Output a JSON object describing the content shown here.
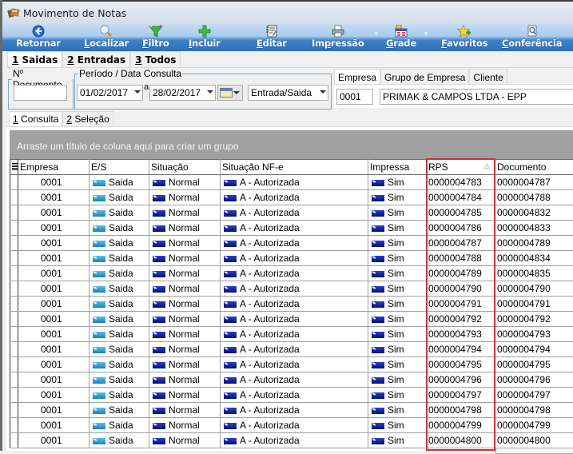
{
  "window": {
    "title": "Movimento de Notas"
  },
  "toolbar": {
    "buttons": [
      {
        "label": "Retornar",
        "accel": "",
        "icon": "back-arrow-icon"
      },
      {
        "label": "Localizar",
        "accel": "L",
        "icon": "magnifier-icon"
      },
      {
        "label": "Filtro",
        "accel": "F",
        "icon": "funnel-icon"
      },
      {
        "label": "Incluir",
        "accel": "I",
        "icon": "plus-icon"
      },
      {
        "label": "Editar",
        "accel": "E",
        "icon": "edit-document-icon"
      },
      {
        "label": "Impressão",
        "accel": "p",
        "icon": "printer-icon",
        "dropdown": true
      },
      {
        "label": "Grade",
        "accel": "G",
        "icon": "grid-icon",
        "dropdown": true
      },
      {
        "label": "Favoritos",
        "accel": "F",
        "icon": "star-icon"
      },
      {
        "label": "Conferência",
        "accel": "C",
        "icon": "check-document-icon"
      }
    ]
  },
  "main_tabs": [
    {
      "key": "1",
      "label": " Saidas",
      "active": true
    },
    {
      "key": "2",
      "label": " Entradas",
      "active": false
    },
    {
      "key": "3",
      "label": " Todos",
      "active": false
    }
  ],
  "filters": {
    "documento_legend": "Nº Documento",
    "documento_value": "",
    "periodo_legend": "Período / Data Consulta",
    "date_from": "01/02/2017",
    "date_separator": "a",
    "date_to": "28/02/2017",
    "tipo_value": "Entrada/Saida"
  },
  "empresa": {
    "tabs": [
      "Empresa",
      "Grupo de Empresa",
      "Cliente"
    ],
    "active_tab": "Empresa",
    "code": "0001",
    "name": "PRIMAK & CAMPOS LTDA - EPP"
  },
  "sub_tabs": [
    {
      "key": "1",
      "label": " Consulta",
      "active": true
    },
    {
      "key": "2",
      "label": " Seleção",
      "active": false
    }
  ],
  "grid": {
    "group_panel_text": "Arraste um título de coluna aqui para criar um grupo",
    "columns": [
      "Empresa",
      "E/S",
      "Situação",
      "Situação NF-e",
      "Impressa",
      "RPS",
      "Documento"
    ],
    "sorted_column": "RPS",
    "sort_direction": "ascending",
    "highlighted_column": "RPS",
    "rows": [
      [
        "0001",
        "Saida",
        "Normal",
        "A - Autorizada",
        "Sim",
        "0000004783",
        "0000004787"
      ],
      [
        "0001",
        "Saida",
        "Normal",
        "A - Autorizada",
        "Sim",
        "0000004784",
        "0000004788"
      ],
      [
        "0001",
        "Saida",
        "Normal",
        "A - Autorizada",
        "Sim",
        "0000004785",
        "0000004832"
      ],
      [
        "0001",
        "Saida",
        "Normal",
        "A - Autorizada",
        "Sim",
        "0000004786",
        "0000004833"
      ],
      [
        "0001",
        "Saida",
        "Normal",
        "A - Autorizada",
        "Sim",
        "0000004787",
        "0000004789"
      ],
      [
        "0001",
        "Saida",
        "Normal",
        "A - Autorizada",
        "Sim",
        "0000004788",
        "0000004834"
      ],
      [
        "0001",
        "Saida",
        "Normal",
        "A - Autorizada",
        "Sim",
        "0000004789",
        "0000004835"
      ],
      [
        "0001",
        "Saida",
        "Normal",
        "A - Autorizada",
        "Sim",
        "0000004790",
        "0000004790"
      ],
      [
        "0001",
        "Saida",
        "Normal",
        "A - Autorizada",
        "Sim",
        "0000004791",
        "0000004791"
      ],
      [
        "0001",
        "Saida",
        "Normal",
        "A - Autorizada",
        "Sim",
        "0000004792",
        "0000004792"
      ],
      [
        "0001",
        "Saida",
        "Normal",
        "A - Autorizada",
        "Sim",
        "0000004793",
        "0000004793"
      ],
      [
        "0001",
        "Saida",
        "Normal",
        "A - Autorizada",
        "Sim",
        "0000004794",
        "0000004794"
      ],
      [
        "0001",
        "Saida",
        "Normal",
        "A - Autorizada",
        "Sim",
        "0000004795",
        "0000004795"
      ],
      [
        "0001",
        "Saida",
        "Normal",
        "A - Autorizada",
        "Sim",
        "0000004796",
        "0000004796"
      ],
      [
        "0001",
        "Saida",
        "Normal",
        "A - Autorizada",
        "Sim",
        "0000004797",
        "0000004797"
      ],
      [
        "0001",
        "Saida",
        "Normal",
        "A - Autorizada",
        "Sim",
        "0000004798",
        "0000004798"
      ],
      [
        "0001",
        "Saida",
        "Normal",
        "A - Autorizada",
        "Sim",
        "0000004799",
        "0000004799"
      ],
      [
        "0001",
        "Saida",
        "Normal",
        "A - Autorizada",
        "Sim",
        "0000004800",
        "0000004800"
      ]
    ]
  },
  "colors": {
    "highlight_border": "#c8353b",
    "group_panel": "#a0a0a0",
    "toolbar_blue": "#2c6fb9",
    "group_box_border": "#79a7c9"
  }
}
